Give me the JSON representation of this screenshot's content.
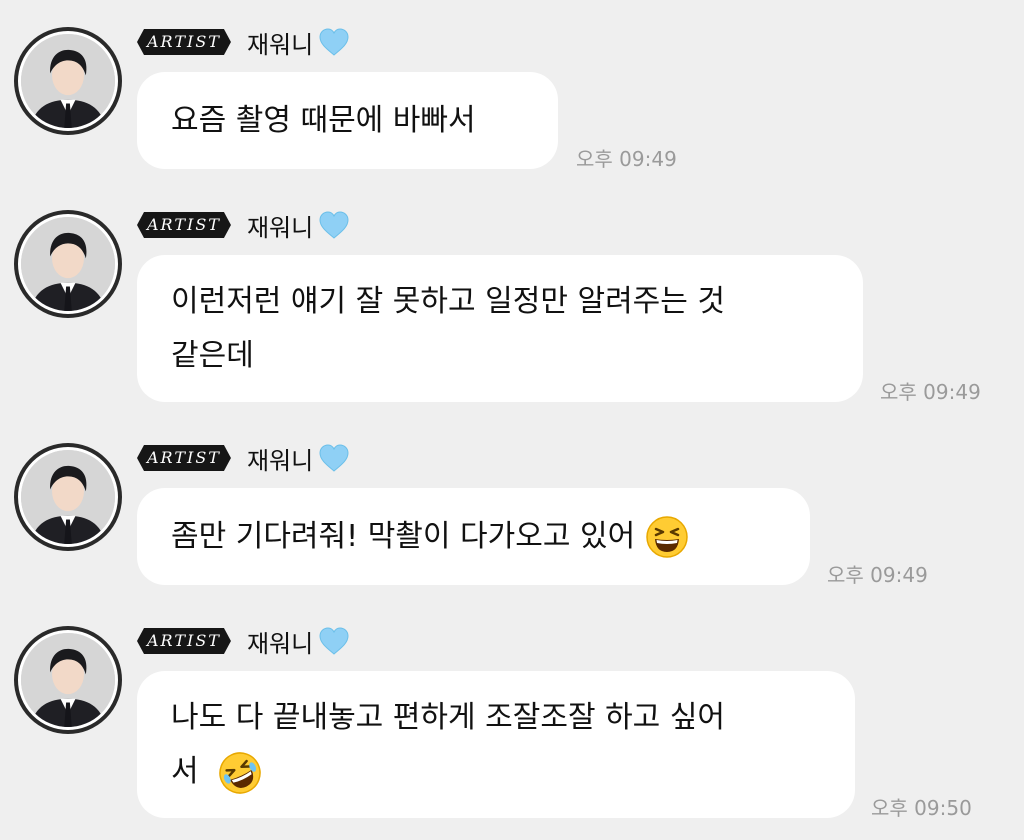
{
  "messages": [
    {
      "badge": "ARTIST",
      "sender": "재워니",
      "text": "요즘 촬영 때문에 바빠서",
      "time": "오후 09:49"
    },
    {
      "badge": "ARTIST",
      "sender": "재워니",
      "text_line1": "이런저런 얘기 잘 못하고 일정만 알려주는 것",
      "text_line2": "같은데",
      "time": "오후 09:49"
    },
    {
      "badge": "ARTIST",
      "sender": "재워니",
      "text": "좀만 기다려줘! 막촬이 다가오고 있어",
      "emoji": "grinning-squinting-face-emoji",
      "time": "오후 09:49"
    },
    {
      "badge": "ARTIST",
      "sender": "재워니",
      "text_line1": "나도 다 끝내놓고 편하게 조잘조잘 하고 싶어",
      "text_line2": "서",
      "emoji": "rolling-on-floor-laughing-emoji",
      "time": "오후 09:50"
    }
  ],
  "colors": {
    "background": "#efefef",
    "bubble": "#ffffff",
    "badge": "#161616",
    "heart": "#8fd0f5",
    "timestamp": "#9a9a9a"
  },
  "icons": {
    "heart": "light-blue-heart-icon",
    "avatar": "profile-photo"
  }
}
